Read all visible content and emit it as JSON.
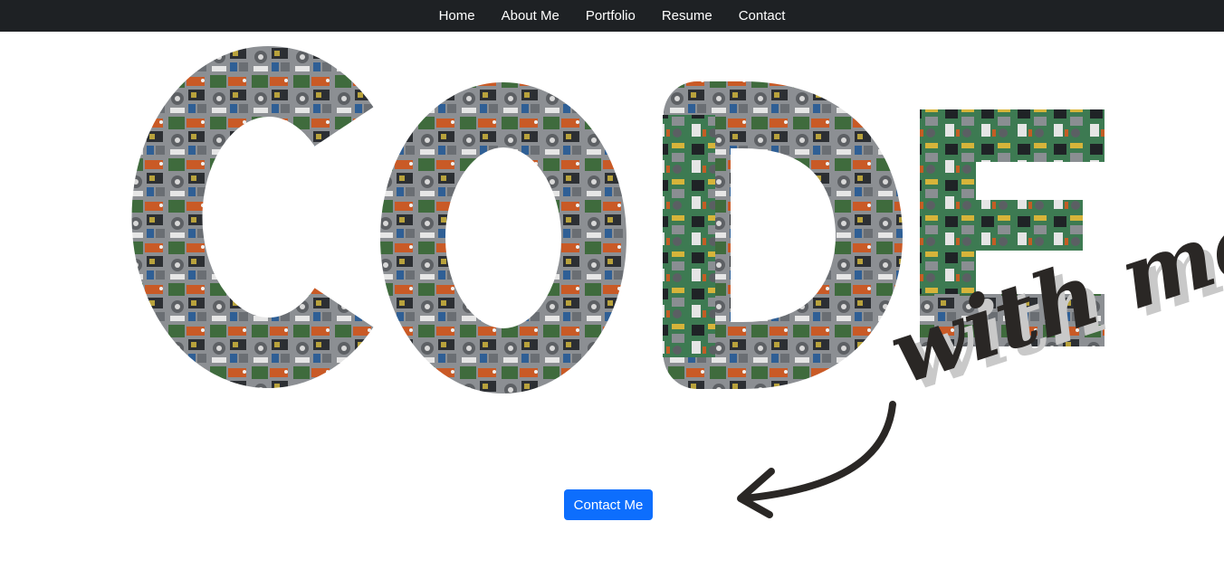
{
  "nav": {
    "items": [
      {
        "label": "Home"
      },
      {
        "label": "About Me"
      },
      {
        "label": "Portfolio"
      },
      {
        "label": "Resume"
      },
      {
        "label": "Contact"
      }
    ]
  },
  "hero": {
    "image_alt": "CODE",
    "script_text": "with me",
    "contact_button": "Contact Me"
  },
  "colors": {
    "navbar_bg": "#1e2124",
    "button_bg": "#0d6efd",
    "script_ink": "#2a2725"
  }
}
